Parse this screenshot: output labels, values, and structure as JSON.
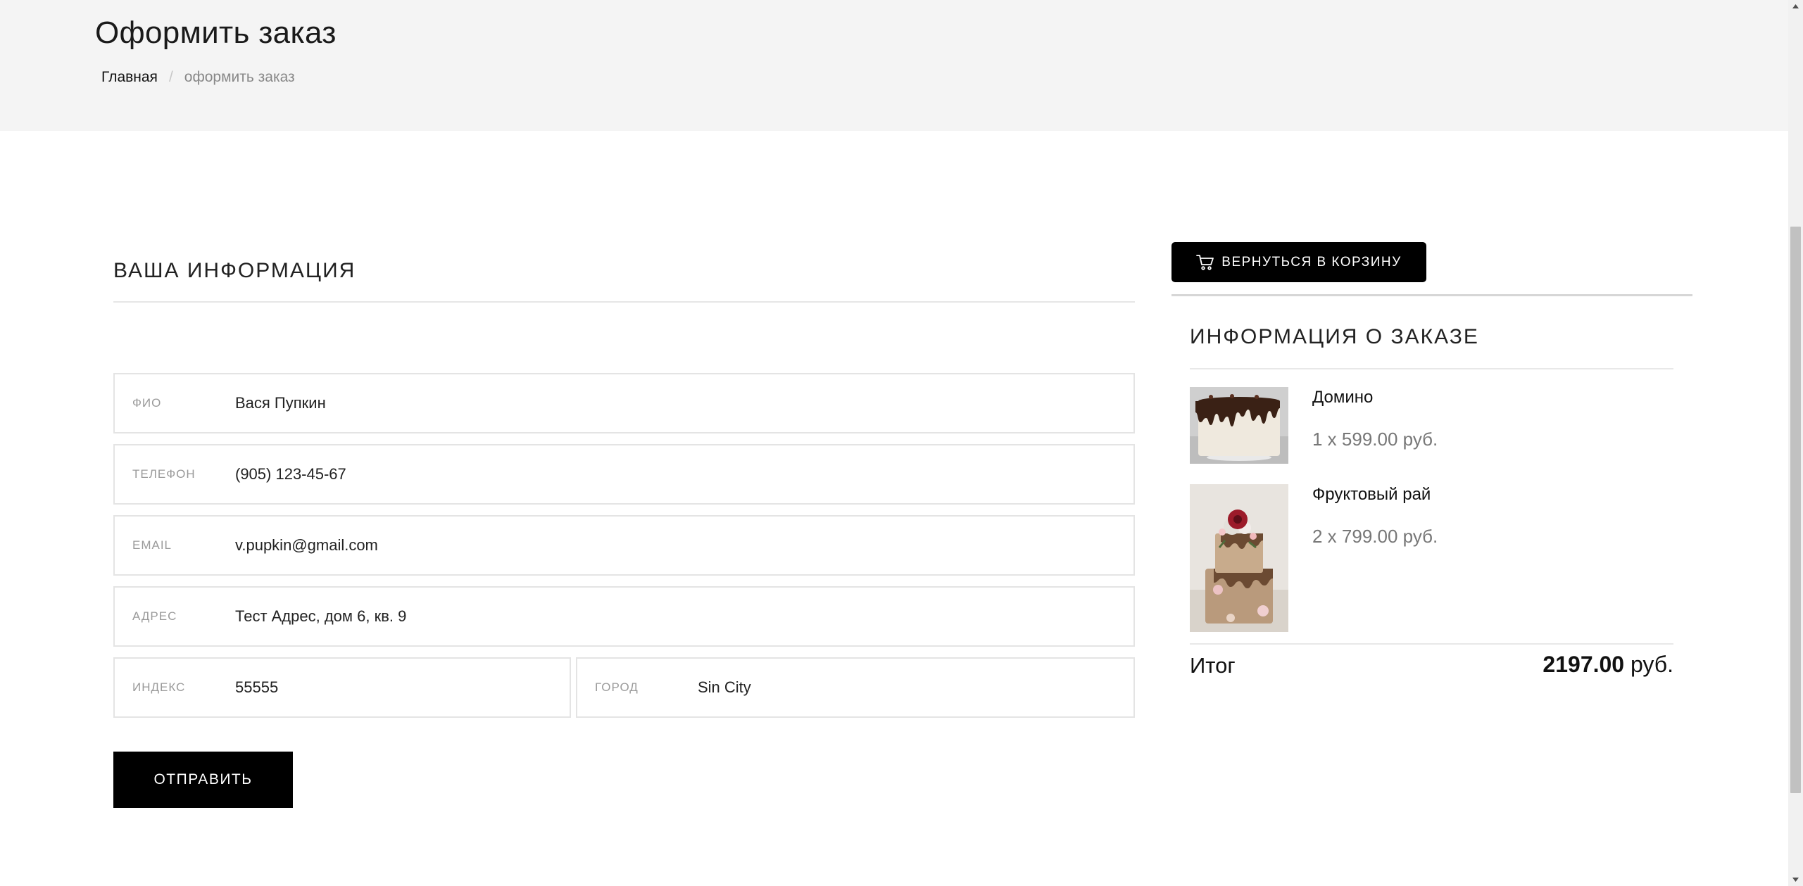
{
  "header": {
    "title": "Оформить заказ",
    "breadcrumb": {
      "home": "Главная",
      "separator": "/",
      "current": "оформить заказ"
    }
  },
  "form": {
    "section_title": "ВАША ИНФОРМАЦИЯ",
    "fields": {
      "name": {
        "label": "ФИО",
        "value": "Вася Пупкин"
      },
      "phone": {
        "label": "ТЕЛЕФОН",
        "value": "(905) 123-45-67"
      },
      "email": {
        "label": "EMAIL",
        "value": "v.pupkin@gmail.com"
      },
      "address": {
        "label": "АДРЕС",
        "value": "Тест Адрес, дом 6, кв. 9"
      },
      "zip": {
        "label": "ИНДЕКС",
        "value": "55555"
      },
      "city": {
        "label": "ГОРОД",
        "value": "Sin City"
      }
    },
    "submit_label": "ОТПРАВИТЬ"
  },
  "order": {
    "back_button_label": "ВЕРНУТЬСЯ В КОРЗИНУ",
    "back_button_icon": "cart-icon",
    "title": "ИНФОРМАЦИЯ О ЗАКАЗЕ",
    "items": [
      {
        "name": "Домино",
        "price": "1 x 599.00 руб.",
        "image": "chocolate-drip-cake-image"
      },
      {
        "name": "Фруктовый рай",
        "price": "2 x 799.00 руб.",
        "image": "flower-naked-cake-image"
      }
    ],
    "total_label": "Итог",
    "total_amount": "2197.00",
    "total_currency": " руб."
  },
  "colors": {
    "header_bg": "#f4f4f4",
    "button_bg": "#000000",
    "muted_text": "#777777"
  }
}
